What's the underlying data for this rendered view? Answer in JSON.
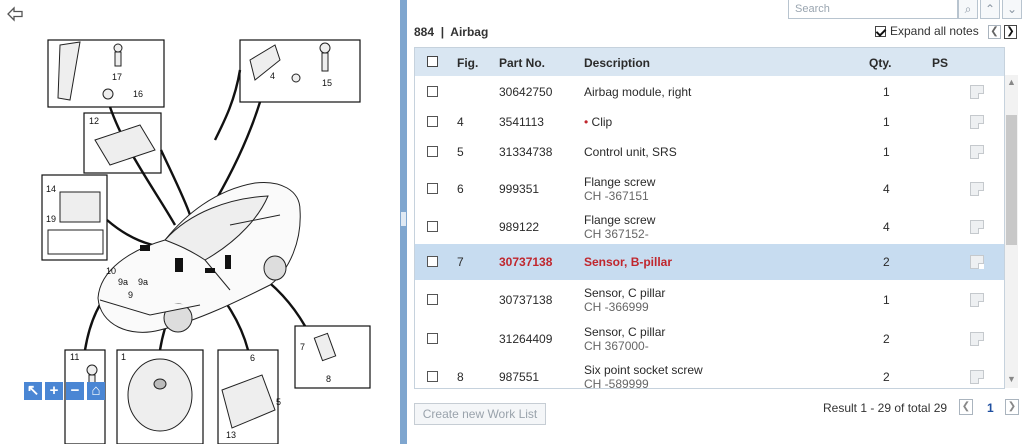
{
  "header": {
    "section_number": "884",
    "section_title": "Airbag",
    "separator": "|",
    "search_placeholder": "Search",
    "expand_all_label": "Expand all notes"
  },
  "table": {
    "columns": [
      "Fig.",
      "Part No.",
      "Description",
      "Qty.",
      "PS"
    ],
    "rows": [
      {
        "fig": "",
        "part_no": "30642750",
        "description": "Airbag module, right",
        "sub": "",
        "qty": "1",
        "bullet": false,
        "selected": false
      },
      {
        "fig": "4",
        "part_no": "3541113",
        "description": "Clip",
        "sub": "",
        "qty": "1",
        "bullet": true,
        "selected": false
      },
      {
        "fig": "5",
        "part_no": "31334738",
        "description": "Control unit, SRS",
        "sub": "",
        "qty": "1",
        "bullet": false,
        "selected": false
      },
      {
        "fig": "6",
        "part_no": "999351",
        "description": "Flange screw",
        "sub": "CH -367151",
        "qty": "4",
        "bullet": false,
        "selected": false
      },
      {
        "fig": "",
        "part_no": "989122",
        "description": "Flange screw",
        "sub": "CH 367152-",
        "qty": "4",
        "bullet": false,
        "selected": false
      },
      {
        "fig": "7",
        "part_no": "30737138",
        "description": "Sensor, B-pillar",
        "sub": "",
        "qty": "2",
        "bullet": false,
        "selected": true
      },
      {
        "fig": "",
        "part_no": "30737138",
        "description": "Sensor, C pillar",
        "sub": "CH -366999",
        "qty": "1",
        "bullet": false,
        "selected": false
      },
      {
        "fig": "",
        "part_no": "31264409",
        "description": "Sensor, C pillar",
        "sub": "CH 367000-",
        "qty": "2",
        "bullet": false,
        "selected": false
      },
      {
        "fig": "8",
        "part_no": "987551",
        "description": "Six point socket screw",
        "sub": "CH -589999",
        "qty": "2",
        "bullet": false,
        "selected": false
      }
    ]
  },
  "footer": {
    "worklist_button": "Create new Work List",
    "result_text": "Result 1 - 29 of total 29",
    "page_number": "1"
  },
  "diagram": {
    "labels": [
      "17",
      "16",
      "12",
      "4",
      "15",
      "14",
      "19",
      "10",
      "9a",
      "9a",
      "9",
      "11",
      "1",
      "6",
      "5",
      "13",
      "7",
      "8"
    ],
    "zoom_tools": [
      "pointer-icon",
      "zoom-in-icon",
      "zoom-out-icon",
      "home-icon"
    ]
  },
  "colors": {
    "header_bg": "#d9e6f2",
    "selected_row_bg": "#c7dcf0",
    "selected_text": "#c0262d",
    "divider": "#7fa6cf",
    "link_blue": "#1f4fa0"
  }
}
